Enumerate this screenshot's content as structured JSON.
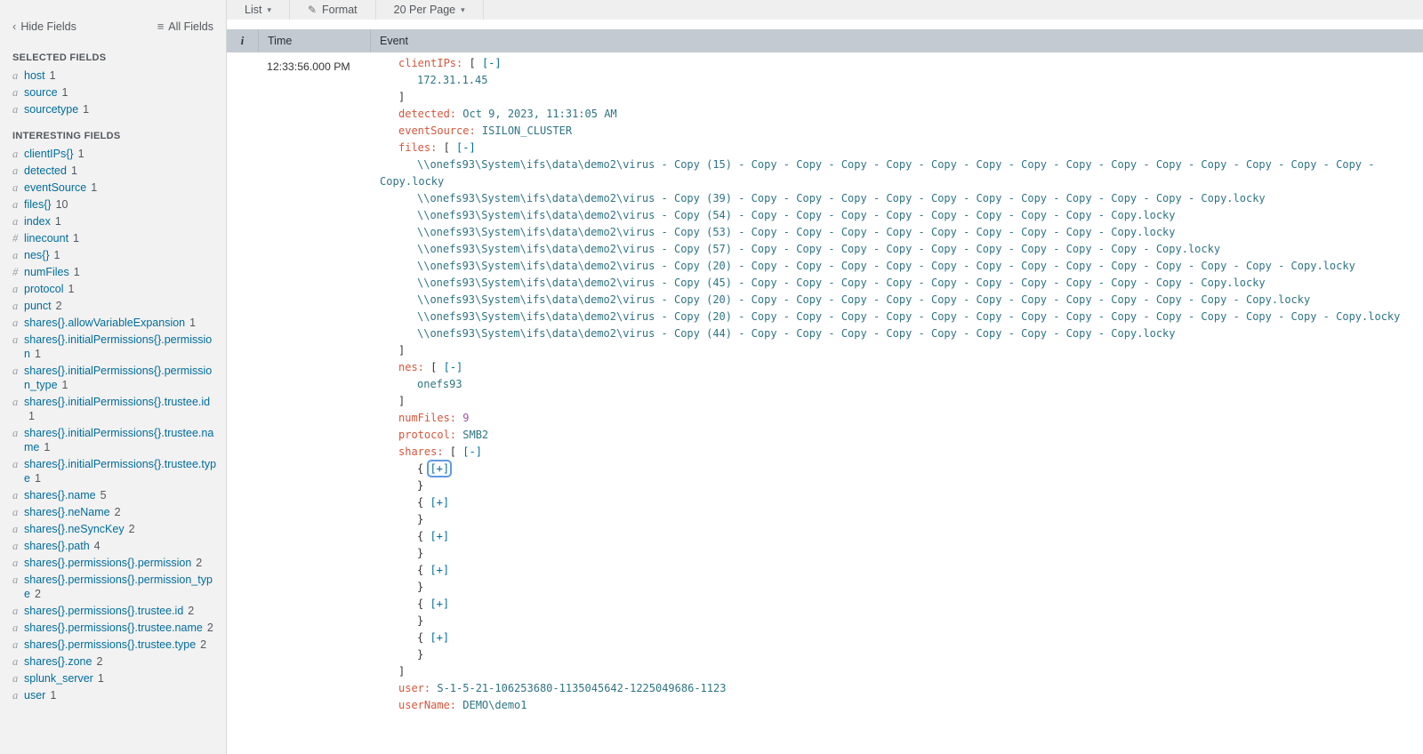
{
  "colors": {
    "key": "#d6563c",
    "string": "#2f7483",
    "number": "#a355a0",
    "link": "#006d9c",
    "punct": "#333333",
    "header_bg": "#c3cad2",
    "sidebar_bg": "#f2f2f2",
    "toolbar_bg": "#efefef",
    "field_link": "#006d9c"
  },
  "icons": {
    "chevron_left": "‹",
    "all_fields": "≡",
    "caret_down": "▾",
    "pencil": "✎"
  },
  "toolbar": {
    "list_label": "List",
    "format_label": "Format",
    "per_page_label": "20 Per Page"
  },
  "table": {
    "col_info": "i",
    "col_time": "Time",
    "col_event": "Event"
  },
  "sidebar": {
    "hide_fields": "Hide Fields",
    "all_fields": "All Fields",
    "selected_heading": "SELECTED FIELDS",
    "interesting_heading": "INTERESTING FIELDS",
    "selected_fields": [
      {
        "type": "a",
        "name": "host",
        "count": "1"
      },
      {
        "type": "a",
        "name": "source",
        "count": "1"
      },
      {
        "type": "a",
        "name": "sourcetype",
        "count": "1"
      }
    ],
    "interesting_fields": [
      {
        "type": "a",
        "name": "clientIPs{}",
        "count": "1"
      },
      {
        "type": "a",
        "name": "detected",
        "count": "1"
      },
      {
        "type": "a",
        "name": "eventSource",
        "count": "1"
      },
      {
        "type": "a",
        "name": "files{}",
        "count": "10"
      },
      {
        "type": "a",
        "name": "index",
        "count": "1"
      },
      {
        "type": "#",
        "name": "linecount",
        "count": "1"
      },
      {
        "type": "a",
        "name": "nes{}",
        "count": "1"
      },
      {
        "type": "#",
        "name": "numFiles",
        "count": "1"
      },
      {
        "type": "a",
        "name": "protocol",
        "count": "1"
      },
      {
        "type": "a",
        "name": "punct",
        "count": "2"
      },
      {
        "type": "a",
        "name": "shares{}.allowVariableExpansion",
        "count": "1"
      },
      {
        "type": "a",
        "name": "shares{}.initialPermissions{}.permission",
        "count": "1"
      },
      {
        "type": "a",
        "name": "shares{}.initialPermissions{}.permission_type",
        "count": "1"
      },
      {
        "type": "a",
        "name": "shares{}.initialPermissions{}.trustee.id",
        "count": "1"
      },
      {
        "type": "a",
        "name": "shares{}.initialPermissions{}.trustee.name",
        "count": "1"
      },
      {
        "type": "a",
        "name": "shares{}.initialPermissions{}.trustee.type",
        "count": "1"
      },
      {
        "type": "a",
        "name": "shares{}.name",
        "count": "5"
      },
      {
        "type": "a",
        "name": "shares{}.neName",
        "count": "2"
      },
      {
        "type": "a",
        "name": "shares{}.neSyncKey",
        "count": "2"
      },
      {
        "type": "a",
        "name": "shares{}.path",
        "count": "4"
      },
      {
        "type": "a",
        "name": "shares{}.permissions{}.permission",
        "count": "2"
      },
      {
        "type": "a",
        "name": "shares{}.permissions{}.permission_type",
        "count": "2"
      },
      {
        "type": "a",
        "name": "shares{}.permissions{}.trustee.id",
        "count": "2"
      },
      {
        "type": "a",
        "name": "shares{}.permissions{}.trustee.name",
        "count": "2"
      },
      {
        "type": "a",
        "name": "shares{}.permissions{}.trustee.type",
        "count": "2"
      },
      {
        "type": "a",
        "name": "shares{}.zone",
        "count": "2"
      },
      {
        "type": "a",
        "name": "splunk_server",
        "count": "1"
      },
      {
        "type": "a",
        "name": "user",
        "count": "1"
      }
    ]
  },
  "event": {
    "time": "12:33:56.000 PM",
    "lines": [
      {
        "i": 1,
        "parts": [
          [
            "key",
            "clientIPs:"
          ],
          [
            "p",
            " [ "
          ],
          [
            "link",
            "[-]"
          ]
        ]
      },
      {
        "i": 2,
        "parts": [
          [
            "str",
            "172.31.1.45"
          ]
        ]
      },
      {
        "i": 1,
        "parts": [
          [
            "p",
            "]"
          ]
        ]
      },
      {
        "i": 1,
        "parts": [
          [
            "key",
            "detected:"
          ],
          [
            "str",
            " Oct 9, 2023, 11:31:05 AM"
          ]
        ]
      },
      {
        "i": 1,
        "parts": [
          [
            "key",
            "eventSource:"
          ],
          [
            "str",
            " ISILON_CLUSTER"
          ]
        ]
      },
      {
        "i": 1,
        "parts": [
          [
            "key",
            "files:"
          ],
          [
            "p",
            " [ "
          ],
          [
            "link",
            "[-]"
          ]
        ]
      },
      {
        "i": 2,
        "parts": [
          [
            "str",
            "\\\\onefs93\\System\\ifs\\data\\demo2\\virus - Copy (15) - Copy - Copy - Copy - Copy - Copy - Copy - Copy - Copy - Copy - Copy - Copy - Copy - Copy - Copy - Copy.locky"
          ]
        ]
      },
      {
        "i": 2,
        "parts": [
          [
            "str",
            "\\\\onefs93\\System\\ifs\\data\\demo2\\virus - Copy (39) - Copy - Copy - Copy - Copy - Copy - Copy - Copy - Copy - Copy - Copy - Copy.locky"
          ]
        ]
      },
      {
        "i": 2,
        "parts": [
          [
            "str",
            "\\\\onefs93\\System\\ifs\\data\\demo2\\virus - Copy (54) - Copy - Copy - Copy - Copy - Copy - Copy - Copy - Copy - Copy.locky"
          ]
        ]
      },
      {
        "i": 2,
        "parts": [
          [
            "str",
            "\\\\onefs93\\System\\ifs\\data\\demo2\\virus - Copy (53) - Copy - Copy - Copy - Copy - Copy - Copy - Copy - Copy - Copy.locky"
          ]
        ]
      },
      {
        "i": 2,
        "parts": [
          [
            "str",
            "\\\\onefs93\\System\\ifs\\data\\demo2\\virus - Copy (57) - Copy - Copy - Copy - Copy - Copy - Copy - Copy - Copy - Copy - Copy.locky"
          ]
        ]
      },
      {
        "i": 2,
        "parts": [
          [
            "str",
            "\\\\onefs93\\System\\ifs\\data\\demo2\\virus - Copy (20) - Copy - Copy - Copy - Copy - Copy - Copy - Copy - Copy - Copy - Copy - Copy - Copy - Copy.locky"
          ]
        ]
      },
      {
        "i": 2,
        "parts": [
          [
            "str",
            "\\\\onefs93\\System\\ifs\\data\\demo2\\virus - Copy (45) - Copy - Copy - Copy - Copy - Copy - Copy - Copy - Copy - Copy - Copy - Copy.locky"
          ]
        ]
      },
      {
        "i": 2,
        "parts": [
          [
            "str",
            "\\\\onefs93\\System\\ifs\\data\\demo2\\virus - Copy (20) - Copy - Copy - Copy - Copy - Copy - Copy - Copy - Copy - Copy - Copy - Copy - Copy.locky"
          ]
        ]
      },
      {
        "i": 2,
        "parts": [
          [
            "str",
            "\\\\onefs93\\System\\ifs\\data\\demo2\\virus - Copy (20) - Copy - Copy - Copy - Copy - Copy - Copy - Copy - Copy - Copy - Copy - Copy - Copy - Copy - Copy.locky"
          ]
        ]
      },
      {
        "i": 2,
        "parts": [
          [
            "str",
            "\\\\onefs93\\System\\ifs\\data\\demo2\\virus - Copy (44) - Copy - Copy - Copy - Copy - Copy - Copy - Copy - Copy - Copy.locky"
          ]
        ]
      },
      {
        "i": 1,
        "parts": [
          [
            "p",
            "]"
          ]
        ]
      },
      {
        "i": 1,
        "parts": [
          [
            "key",
            "nes:"
          ],
          [
            "p",
            " [ "
          ],
          [
            "link",
            "[-]"
          ]
        ]
      },
      {
        "i": 2,
        "parts": [
          [
            "str",
            "onefs93"
          ]
        ]
      },
      {
        "i": 1,
        "parts": [
          [
            "p",
            "]"
          ]
        ]
      },
      {
        "i": 1,
        "parts": [
          [
            "key",
            "numFiles:"
          ],
          [
            "num",
            " 9"
          ]
        ]
      },
      {
        "i": 1,
        "parts": [
          [
            "key",
            "protocol:"
          ],
          [
            "str",
            " SMB2"
          ]
        ]
      },
      {
        "i": 1,
        "parts": [
          [
            "key",
            "shares:"
          ],
          [
            "p",
            " [ "
          ],
          [
            "link",
            "[-]"
          ]
        ]
      },
      {
        "i": 2,
        "parts": [
          [
            "p",
            "{ "
          ],
          [
            "linkf",
            "[+]"
          ]
        ]
      },
      {
        "i": 2,
        "parts": [
          [
            "p",
            "}"
          ]
        ]
      },
      {
        "i": 2,
        "parts": [
          [
            "p",
            "{ "
          ],
          [
            "link",
            "[+]"
          ]
        ]
      },
      {
        "i": 2,
        "parts": [
          [
            "p",
            "}"
          ]
        ]
      },
      {
        "i": 2,
        "parts": [
          [
            "p",
            "{ "
          ],
          [
            "link",
            "[+]"
          ]
        ]
      },
      {
        "i": 2,
        "parts": [
          [
            "p",
            "}"
          ]
        ]
      },
      {
        "i": 2,
        "parts": [
          [
            "p",
            "{ "
          ],
          [
            "link",
            "[+]"
          ]
        ]
      },
      {
        "i": 2,
        "parts": [
          [
            "p",
            "}"
          ]
        ]
      },
      {
        "i": 2,
        "parts": [
          [
            "p",
            "{ "
          ],
          [
            "link",
            "[+]"
          ]
        ]
      },
      {
        "i": 2,
        "parts": [
          [
            "p",
            "}"
          ]
        ]
      },
      {
        "i": 2,
        "parts": [
          [
            "p",
            "{ "
          ],
          [
            "link",
            "[+]"
          ]
        ]
      },
      {
        "i": 2,
        "parts": [
          [
            "p",
            "}"
          ]
        ]
      },
      {
        "i": 1,
        "parts": [
          [
            "p",
            "]"
          ]
        ]
      },
      {
        "i": 1,
        "parts": [
          [
            "key",
            "user:"
          ],
          [
            "str",
            " S-1-5-21-106253680-1135045642-1225049686-1123"
          ]
        ]
      },
      {
        "i": 1,
        "parts": [
          [
            "key",
            "userName:"
          ],
          [
            "str",
            " DEMO\\demo1"
          ]
        ]
      }
    ]
  }
}
